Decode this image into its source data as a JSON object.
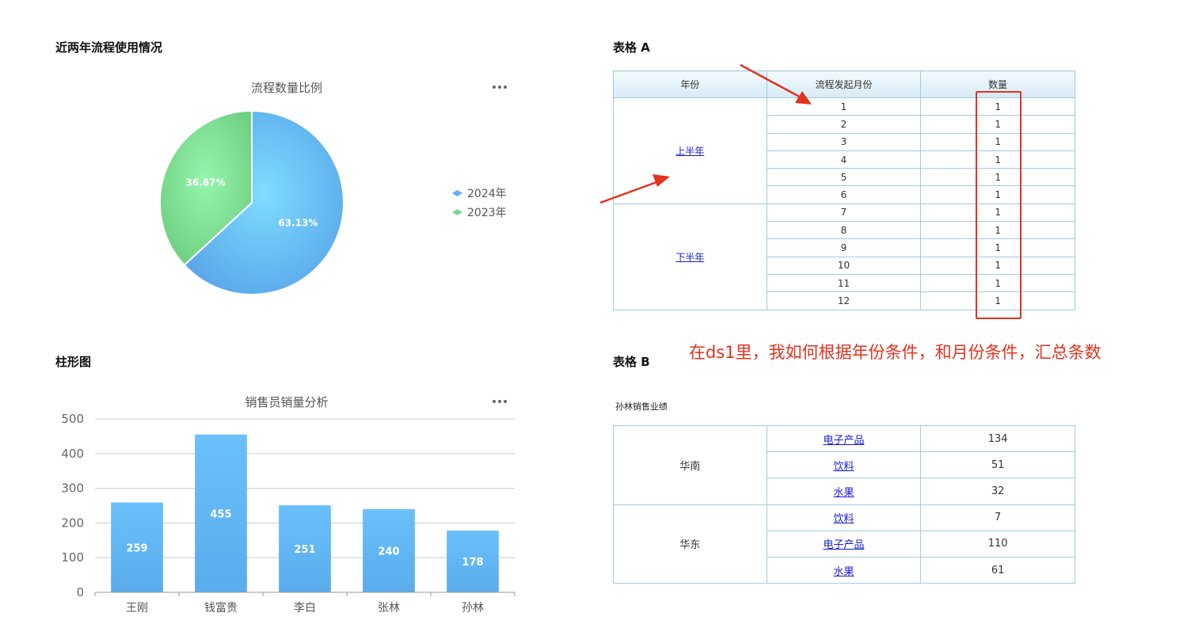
{
  "sections": {
    "pie_section_title": "近两年流程使用情况",
    "bar_section_title": "柱形图",
    "table_a_title": "表格 A",
    "table_b_title": "表格 B"
  },
  "pie_chart": {
    "title": "流程数量比例",
    "more_icon": "more-dots-icon",
    "legend": [
      {
        "label": "2024年",
        "color": "#62aef0"
      },
      {
        "label": "2023年",
        "color": "#7bd68d"
      }
    ],
    "labels": [
      "63.13%",
      "36.87%"
    ]
  },
  "bar_chart": {
    "title": "销售员销量分析",
    "more_icon": "more-dots-icon",
    "y_ticks": [
      "0",
      "100",
      "200",
      "300",
      "400",
      "500"
    ],
    "categories": [
      "王刚",
      "钱富贵",
      "李白",
      "张林",
      "孙林"
    ],
    "value_labels": [
      "259",
      "455",
      "251",
      "240",
      "178"
    ]
  },
  "chart_data": [
    {
      "type": "pie",
      "title": "流程数量比例",
      "categories": [
        "2024年",
        "2023年"
      ],
      "values": [
        63.13,
        36.87
      ],
      "unit": "%",
      "legend": "right"
    },
    {
      "type": "bar",
      "title": "销售员销量分析",
      "categories": [
        "王刚",
        "钱富贵",
        "李白",
        "张林",
        "孙林"
      ],
      "values": [
        259,
        455,
        251,
        240,
        178
      ],
      "ylim": [
        0,
        500
      ],
      "grid": true
    }
  ],
  "table_a": {
    "headers": [
      "年份",
      "流程发起月份",
      "数量"
    ],
    "groups": [
      {
        "label": "上半年",
        "rows": [
          [
            "1",
            "1"
          ],
          [
            "2",
            "1"
          ],
          [
            "3",
            "1"
          ],
          [
            "4",
            "1"
          ],
          [
            "5",
            "1"
          ],
          [
            "6",
            "1"
          ]
        ]
      },
      {
        "label": "下半年",
        "rows": [
          [
            "7",
            "1"
          ],
          [
            "8",
            "1"
          ],
          [
            "9",
            "1"
          ],
          [
            "10",
            "1"
          ],
          [
            "11",
            "1"
          ],
          [
            "12",
            "1"
          ]
        ]
      }
    ]
  },
  "table_b": {
    "caption": "孙林销售业绩",
    "groups": [
      {
        "label": "华南",
        "rows": [
          [
            "电子产品",
            "134"
          ],
          [
            "饮料",
            "51"
          ],
          [
            "水果",
            "32"
          ]
        ]
      },
      {
        "label": "华东",
        "rows": [
          [
            "饮料",
            "7"
          ],
          [
            "电子产品",
            "110"
          ],
          [
            "水果",
            "61"
          ]
        ]
      }
    ]
  },
  "annotation": {
    "text": "在ds1里，我如何根据年份条件，和月份条件，汇总条数",
    "color": "#e3321e"
  }
}
